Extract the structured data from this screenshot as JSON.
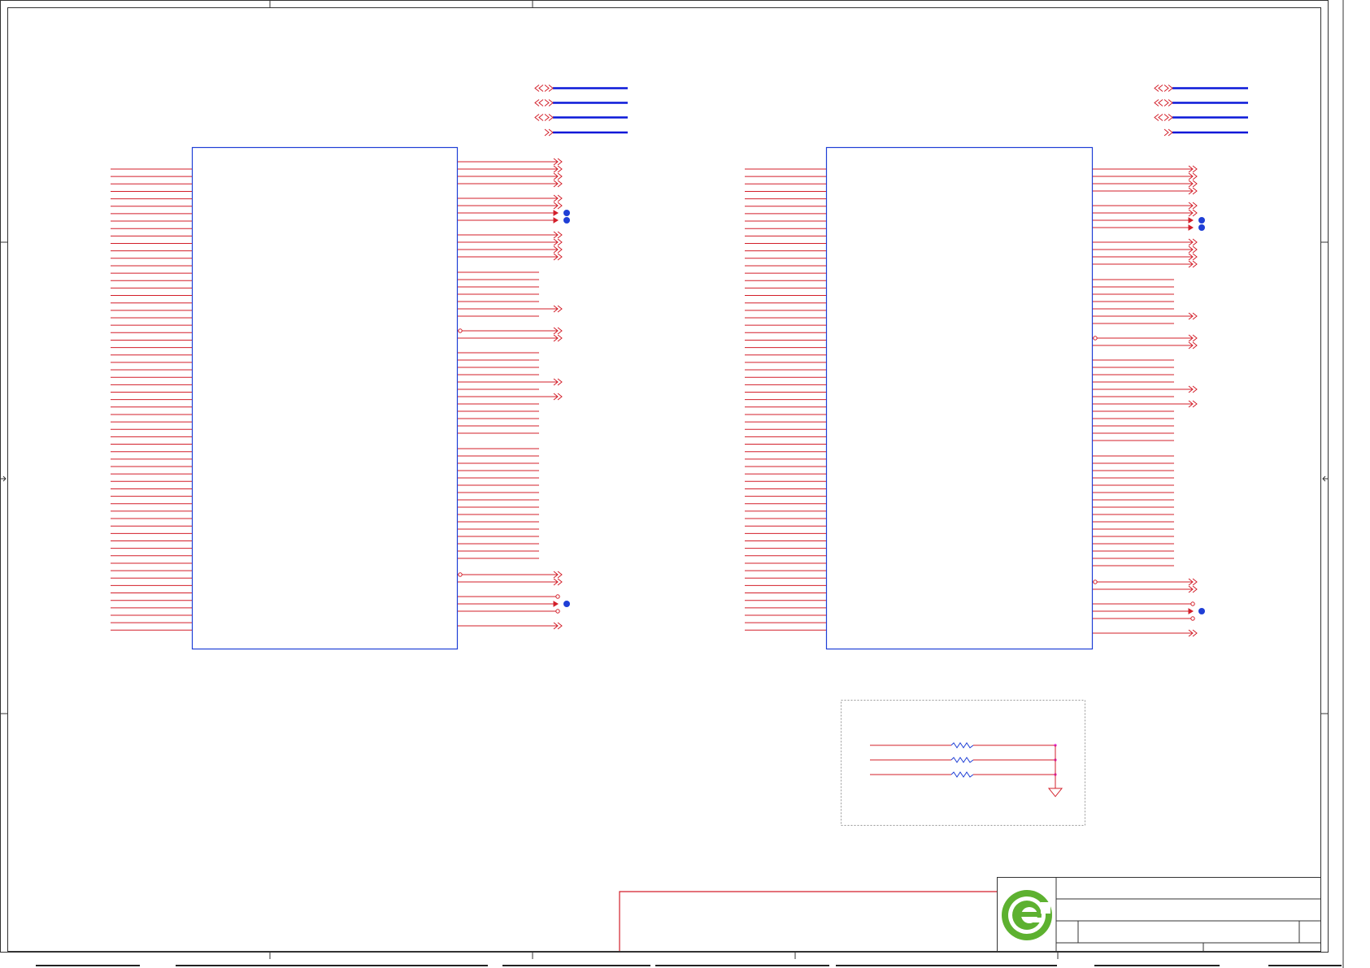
{
  "sheet": {
    "colors": {
      "border": "#333333",
      "wire": "#d31f2a",
      "component": "#1f3fd6",
      "bus": "#0a18d8",
      "junction": "#1f3fd6",
      "note_box": "#999999",
      "title_block": "#333333",
      "logo_green": "#5db130"
    }
  },
  "symbols": {
    "left_ic": "connector-ic-left",
    "right_ic": "connector-ic-right",
    "resistor_group": "resistor-network",
    "ground": "ground-symbol",
    "logo": "company-logo"
  },
  "title_block": {
    "logo_name": "green-e-logo",
    "fields": []
  }
}
